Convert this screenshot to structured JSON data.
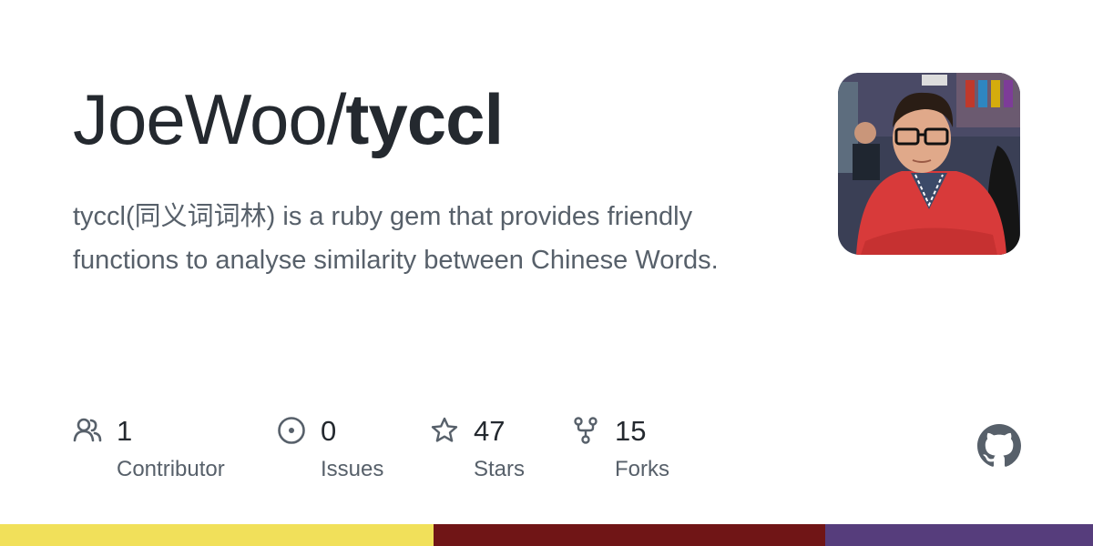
{
  "repo": {
    "owner": "JoeWoo/",
    "name": "tyccl",
    "description": "tyccl(同义词词林) is a ruby gem that provides friendly functions to analyse similarity between Chinese Words."
  },
  "stats": [
    {
      "icon": "people-icon",
      "count": "1",
      "label": "Contributor"
    },
    {
      "icon": "issue-icon",
      "count": "0",
      "label": "Issues"
    },
    {
      "icon": "star-icon",
      "count": "47",
      "label": "Stars"
    },
    {
      "icon": "fork-icon",
      "count": "15",
      "label": "Forks"
    }
  ],
  "languages": [
    {
      "color": "#f1e05a",
      "share": 0.397
    },
    {
      "color": "#701516",
      "share": 0.358
    },
    {
      "color": "#563d7c",
      "share": 0.245
    }
  ],
  "colors": {
    "title": "#24292f",
    "muted": "#57606a",
    "github_logo": "#57606a"
  }
}
